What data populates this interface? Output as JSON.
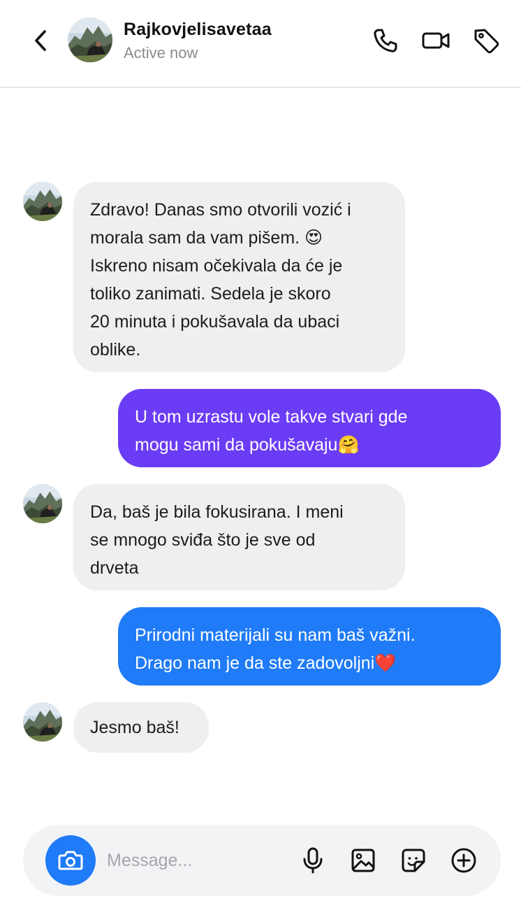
{
  "header": {
    "contact_name": "Rajkovjelisavetaa",
    "status": "Active now"
  },
  "messages": [
    {
      "direction": "incoming",
      "lines": [
        "Zdravo! Danas smo otvorili vozić i",
        "morala sam da vam pišem. 😍",
        "Iskreno nisam očekivala da će je",
        "toliko zanimati. Sedela je skoro",
        "20 minuta i pokušavala da ubaci",
        "oblike."
      ]
    },
    {
      "direction": "outgoing",
      "color": "#6b3cf5",
      "lines": [
        "U tom uzrastu vole takve stvari gde",
        "mogu sami da pokušavaju🤗"
      ]
    },
    {
      "direction": "incoming",
      "lines": [
        "Da, baš je bila fokusirana. I meni",
        "se mnogo sviđa što je sve od",
        "drveta"
      ]
    },
    {
      "direction": "outgoing",
      "color": "#1f7bf7",
      "lines": [
        "Prirodni materijali su nam baš važni.",
        "Drago nam je da ste zadovoljni❤️"
      ]
    },
    {
      "direction": "incoming",
      "lines": [
        "Jesmo baš!"
      ]
    }
  ],
  "composer": {
    "placeholder": "Message..."
  },
  "icons": {
    "back": "chevron-left-icon",
    "call": "phone-icon",
    "video": "video-camera-icon",
    "tag": "tag-icon",
    "camera": "camera-icon",
    "mic": "microphone-icon",
    "gallery": "image-icon",
    "sticker": "sticker-icon",
    "more": "plus-circle-icon"
  },
  "colors": {
    "incoming_bubble": "#efefef",
    "accent_blue": "#1f7bf7",
    "accent_purple": "#6b3cf5"
  }
}
